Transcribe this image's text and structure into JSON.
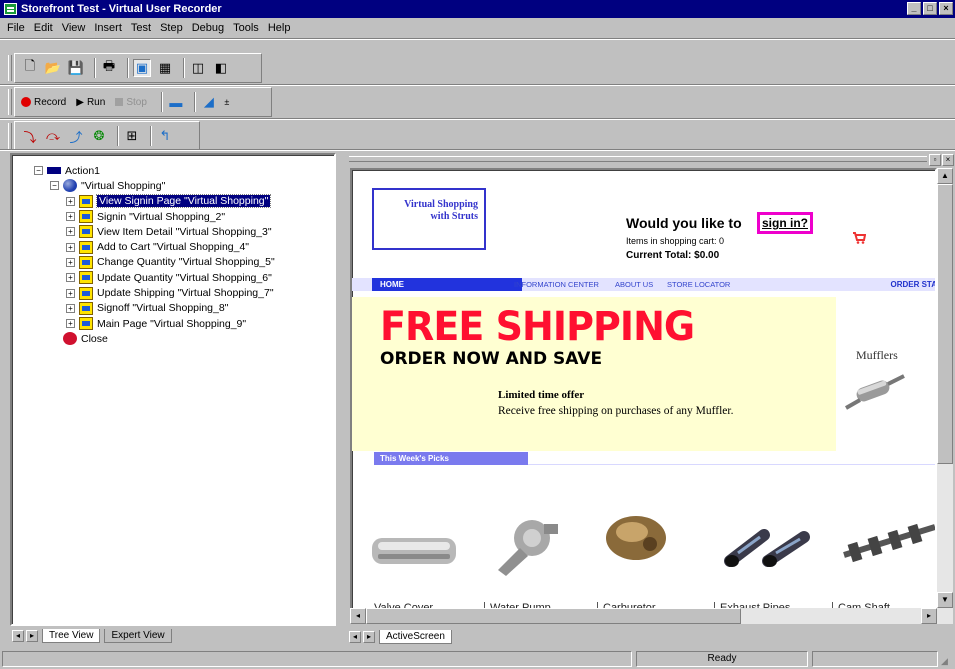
{
  "window": {
    "title": "Storefront Test - Virtual User Recorder"
  },
  "menu": [
    "File",
    "Edit",
    "View",
    "Insert",
    "Test",
    "Step",
    "Debug",
    "Tools",
    "Help"
  ],
  "toolbar_record": {
    "record_label": "Record",
    "run_label": "Run",
    "stop_label": "Stop"
  },
  "tree": {
    "nodes": [
      {
        "label": "Action1",
        "icon": "action-icon",
        "depth": 0,
        "expander": "−"
      },
      {
        "label": "\"Virtual Shopping\"",
        "icon": "globe-icon",
        "depth": 1,
        "expander": "−"
      },
      {
        "label": "View Signin Page \"Virtual Shopping\"",
        "icon": "page-icon",
        "depth": 2,
        "expander": "+",
        "selected": true
      },
      {
        "label": "Signin \"Virtual Shopping_2\"",
        "icon": "page-icon",
        "depth": 2,
        "expander": "+"
      },
      {
        "label": "View Item Detail \"Virtual Shopping_3\"",
        "icon": "page-icon",
        "depth": 2,
        "expander": "+"
      },
      {
        "label": "Add to Cart \"Virtual Shopping_4\"",
        "icon": "page-icon",
        "depth": 2,
        "expander": "+"
      },
      {
        "label": "Change Quantity \"Virtual Shopping_5\"",
        "icon": "page-icon",
        "depth": 2,
        "expander": "+"
      },
      {
        "label": "Update Quantity \"Virtual Shopping_6\"",
        "icon": "page-icon",
        "depth": 2,
        "expander": "+"
      },
      {
        "label": "Update Shipping \"Virtual Shopping_7\"",
        "icon": "page-icon",
        "depth": 2,
        "expander": "+"
      },
      {
        "label": "Signoff \"Virtual Shopping_8\"",
        "icon": "page-icon",
        "depth": 2,
        "expander": "+"
      },
      {
        "label": "Main Page \"Virtual Shopping_9\"",
        "icon": "page-icon",
        "depth": 2,
        "expander": "+"
      },
      {
        "label": "Close",
        "icon": "close-browser-icon",
        "depth": 1,
        "expander": ""
      }
    ]
  },
  "left_tabs": [
    "Tree View",
    "Expert View"
  ],
  "right_tabs": [
    "ActiveScreen"
  ],
  "webpage": {
    "logo_line1": "Virtual Shopping",
    "logo_line2": "with Struts",
    "would_like": "Would you like to",
    "sign_in": "sign in?",
    "items_in_cart": "Items in shopping cart: 0",
    "current_total": "Current Total: $0.00",
    "nav": {
      "home": "HOME",
      "info": "INFORMATION CENTER",
      "about": "ABOUT US",
      "locator": "STORE LOCATOR",
      "order": "ORDER STA"
    },
    "promo": {
      "headline": "FREE SHIPPING",
      "subhead": "ORDER NOW AND SAVE",
      "limited": "Limited time offer",
      "receive": "Receive free shipping on purchases of any Muffler."
    },
    "mufflers_label": "Mufflers",
    "weekly_picks": "This Week's Picks",
    "products": [
      "Valve Cover",
      "Water Pump",
      "Carburetor",
      "Exhaust Pipes",
      "Cam Shaft"
    ]
  },
  "status": {
    "ready": "Ready"
  }
}
